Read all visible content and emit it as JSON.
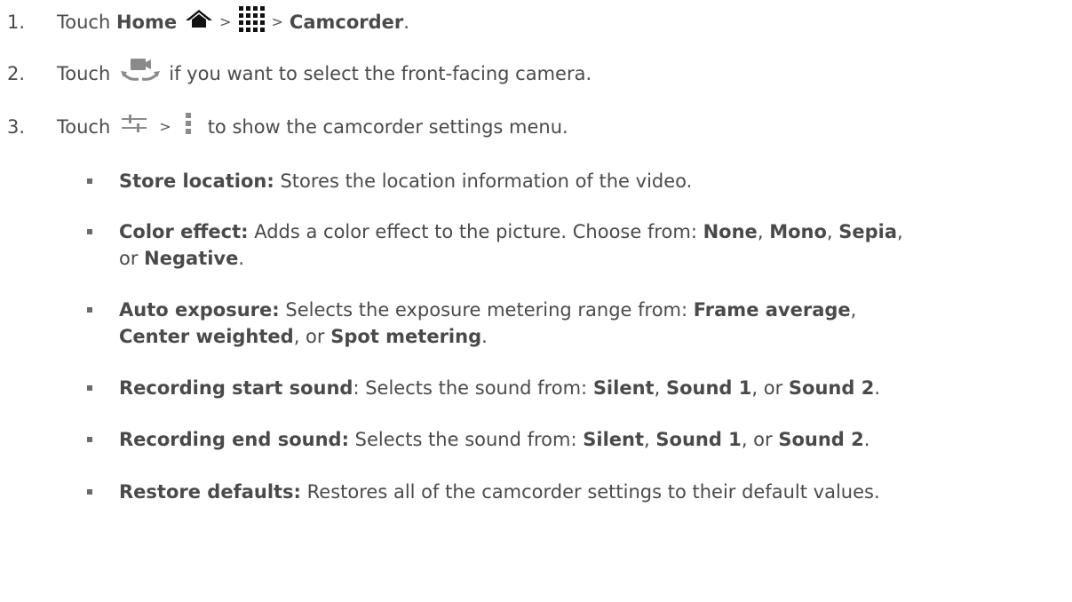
{
  "steps": [
    {
      "num": "1.",
      "parts": {
        "touch": "Touch",
        "home": "Home",
        "gt1": ">",
        "gt2": ">",
        "camcorder": "Camcorder",
        "end": "."
      }
    },
    {
      "num": "2.",
      "parts": {
        "touch": "Touch",
        "rest": "if you want to select the front-facing camera."
      }
    },
    {
      "num": "3.",
      "parts": {
        "touch": "Touch",
        "gt": ">",
        "rest": "to show the camcorder settings menu."
      }
    }
  ],
  "settings": [
    {
      "name": "Store location:",
      "desc": "Stores the location information of the video."
    },
    {
      "name": "Color effect:",
      "desc1": "Adds a color effect to the picture. Choose from:",
      "opt1": "None",
      "c1": ",",
      "opt2": "Mono",
      "c2": ",",
      "opt3": "Sepia",
      "c3": ",",
      "or": "or",
      "opt4": "Negative",
      "end": "."
    },
    {
      "name": "Auto exposure:",
      "desc1": "Selects the exposure metering range from:",
      "opt1": "Frame average",
      "c1": ",",
      "opt2": "Center weighted",
      "c2": ", or",
      "opt3": "Spot metering",
      "end": "."
    },
    {
      "name": "Recording start sound",
      "colon": ":",
      "desc": "Selects the sound from:",
      "opt1": "Silent",
      "c1": ",",
      "opt2": "Sound 1",
      "c2": ", or",
      "opt3": "Sound 2",
      "end": "."
    },
    {
      "name": "Recording end sound:",
      "desc": "Selects the sound from:",
      "opt1": "Silent",
      "c1": ",",
      "opt2": "Sound 1",
      "c2": ", or",
      "opt3": "Sound 2",
      "end": "."
    },
    {
      "name": "Restore defaults:",
      "desc": "Restores all of the camcorder settings to their default values."
    }
  ],
  "icons": {
    "home": "home-icon",
    "apps": "apps-grid-icon",
    "switch_camera": "switch-camera-icon",
    "settings_sliders": "settings-sliders-icon",
    "overflow": "overflow-menu-icon"
  }
}
